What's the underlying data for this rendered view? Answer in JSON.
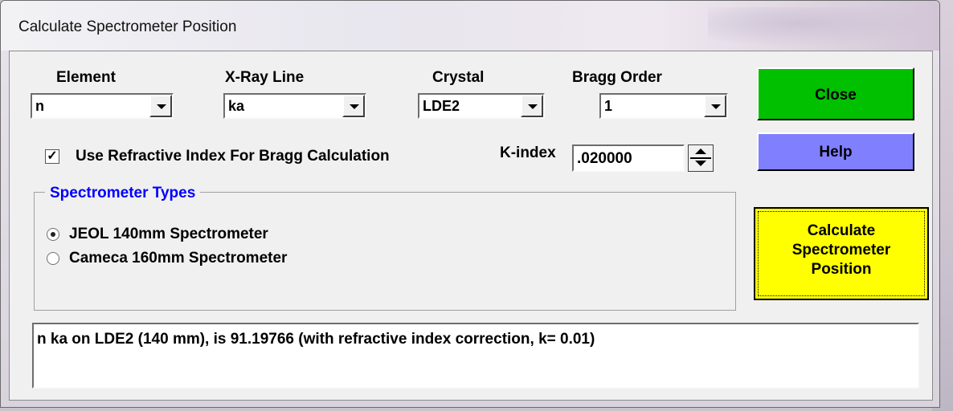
{
  "window": {
    "title": "Calculate Spectrometer Position"
  },
  "element": {
    "label": "Element",
    "value": "n"
  },
  "xray_line": {
    "label": "X-Ray Line",
    "value": "ka"
  },
  "crystal": {
    "label": "Crystal",
    "value": "LDE2"
  },
  "bragg_order": {
    "label": "Bragg Order",
    "value": "1"
  },
  "refractive": {
    "label": "Use Refractive Index For Bragg Calculation",
    "checked": true
  },
  "kindex": {
    "label": "K-index",
    "value": ".020000"
  },
  "spectrometer_types": {
    "title": "Spectrometer Types",
    "options": [
      {
        "label": "JEOL 140mm Spectrometer",
        "selected": true
      },
      {
        "label": "Cameca 160mm Spectrometer",
        "selected": false
      }
    ]
  },
  "buttons": {
    "close": "Close",
    "help": "Help",
    "calculate_line1": "Calculate",
    "calculate_line2": "Spectrometer",
    "calculate_line3": "Position"
  },
  "colors": {
    "close": "#00c000",
    "help": "#8080ff",
    "calculate": "#ffff00",
    "group_title": "#0000ff"
  },
  "output": {
    "text": "n  ka on LDE2 (140 mm), is 91.19766 (with refractive index correction, k= 0.01)"
  }
}
